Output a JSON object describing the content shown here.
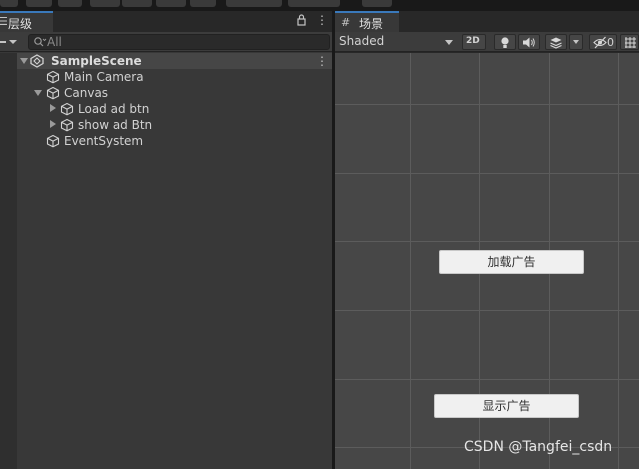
{
  "hierarchy": {
    "tab_label": "层级",
    "search_placeholder": "All",
    "scene_name": "SampleScene",
    "items": [
      {
        "label": "Main Camera"
      },
      {
        "label": "Canvas"
      },
      {
        "label": "Load ad btn"
      },
      {
        "label": "show ad Btn"
      },
      {
        "label": "EventSystem"
      }
    ]
  },
  "scene_view": {
    "tab_label": "场景",
    "shading_mode": "Shaded",
    "btn_2d": "2D",
    "hidden_count": "0",
    "buttons": {
      "load": "加载广告",
      "show": "显示广告"
    }
  },
  "watermark": "CSDN @Tangfei_csdn",
  "colors": {
    "accent": "#3a79bb",
    "panel": "#383838",
    "viewport": "#474747",
    "grid": "#5c5c5c",
    "button_bg": "#f0f0f0"
  },
  "icons": [
    "menu-icon",
    "lock-icon",
    "kebab-icon",
    "search-icon",
    "unity-scene-icon",
    "gameobject-cube-icon",
    "scene-grid-icon",
    "light-icon",
    "audio-icon",
    "effects-icon",
    "hidden-eye-icon",
    "gizmos-icon"
  ]
}
